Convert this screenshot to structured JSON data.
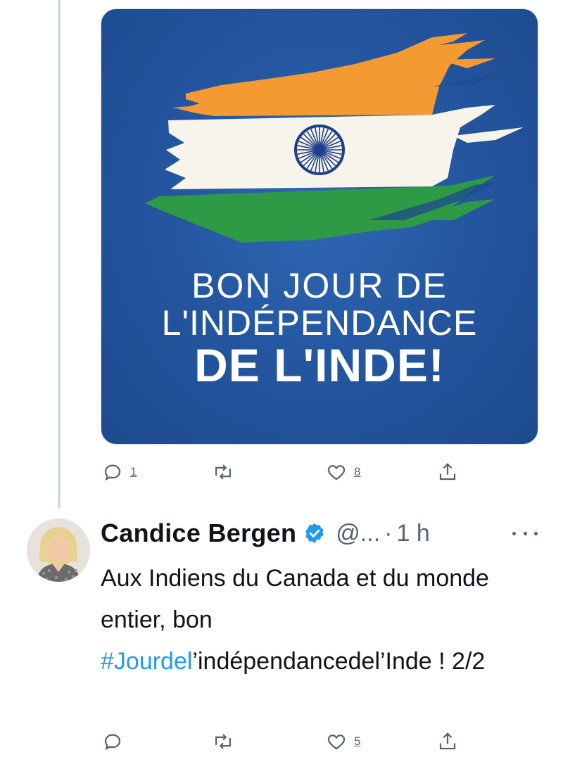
{
  "media": {
    "line1": "BON JOUR DE",
    "line2": "L'INDÉPENDANCE",
    "line3": "DE L'INDE!",
    "colors": {
      "background": "#23549d",
      "saffron": "#f39a32",
      "white": "#f7f4ec",
      "green": "#2f9a45",
      "chakra": "#1f3f8c"
    }
  },
  "first_actions": {
    "reply_count": "1",
    "retweet_count": "",
    "like_count": "8"
  },
  "tweet": {
    "author_name": "Candice Bergen",
    "handle": "@...",
    "time": "1 h",
    "text_before": "Aux Indiens du Canada et du monde entier, bon ",
    "hashtag": "#Jourdel",
    "text_after": "’indépendancedel’Inde ! 2/2",
    "verified_color": "#1d9bf0"
  },
  "second_actions": {
    "reply_count": "",
    "retweet_count": "",
    "like_count": "5"
  },
  "icons": [
    "reply-icon",
    "retweet-icon",
    "like-icon",
    "share-icon",
    "verified-badge-icon",
    "more-icon"
  ]
}
